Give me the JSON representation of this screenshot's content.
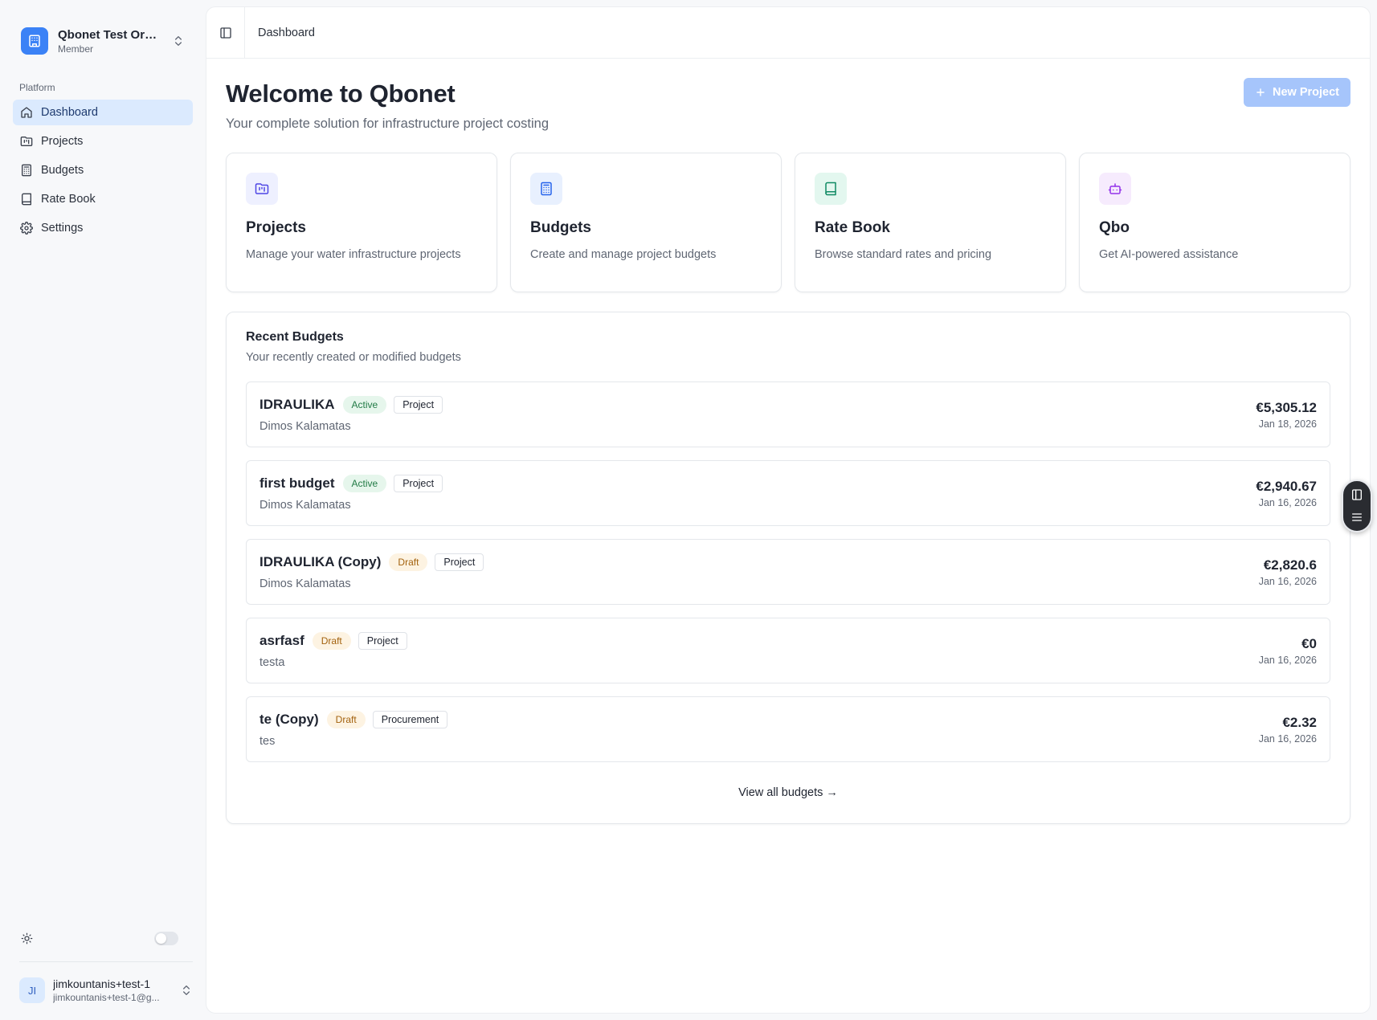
{
  "org": {
    "name": "Qbonet Test Orga...",
    "role": "Member"
  },
  "sidebar": {
    "section_label": "Platform",
    "items": [
      {
        "label": "Dashboard",
        "icon": "home-icon",
        "active": true
      },
      {
        "label": "Projects",
        "icon": "folder-kanban-icon"
      },
      {
        "label": "Budgets",
        "icon": "calculator-icon"
      },
      {
        "label": "Rate Book",
        "icon": "book-icon"
      },
      {
        "label": "Settings",
        "icon": "gear-icon"
      }
    ]
  },
  "user": {
    "initials": "JI",
    "name": "jimkountanis+test-1",
    "email": "jimkountanis+test-1@g..."
  },
  "header": {
    "breadcrumb": "Dashboard"
  },
  "page": {
    "title": "Welcome to Qbonet",
    "subtitle": "Your complete solution for infrastructure project costing",
    "new_button": "New Project"
  },
  "cards": [
    {
      "title": "Projects",
      "desc": "Manage your water infrastructure projects",
      "icon": "folder-kanban-icon",
      "bg": "#eef0ff",
      "fg": "#4f46e5"
    },
    {
      "title": "Budgets",
      "desc": "Create and manage project budgets",
      "icon": "calculator-icon",
      "bg": "#e8f0fe",
      "fg": "#2563eb"
    },
    {
      "title": "Rate Book",
      "desc": "Browse standard rates and pricing",
      "icon": "book-icon",
      "bg": "#e3f7ef",
      "fg": "#0f8a63"
    },
    {
      "title": "Qbo",
      "desc": "Get AI-powered assistance",
      "icon": "bot-icon",
      "bg": "#f6ebfd",
      "fg": "#9333ea"
    }
  ],
  "recent": {
    "title": "Recent Budgets",
    "subtitle": "Your recently created or modified budgets",
    "budgets": [
      {
        "name": "IDRAULIKA",
        "status": "Active",
        "type": "Project",
        "client": "Dimos Kalamatas",
        "amount": "€5,305.12",
        "date": "Jan 18, 2026"
      },
      {
        "name": "first budget",
        "status": "Active",
        "type": "Project",
        "client": "Dimos Kalamatas",
        "amount": "€2,940.67",
        "date": "Jan 16, 2026"
      },
      {
        "name": "IDRAULIKA (Copy)",
        "status": "Draft",
        "type": "Project",
        "client": "Dimos Kalamatas",
        "amount": "€2,820.6",
        "date": "Jan 16, 2026"
      },
      {
        "name": "asrfasf",
        "status": "Draft",
        "type": "Project",
        "client": "testa",
        "amount": "€0",
        "date": "Jan 16, 2026"
      },
      {
        "name": "te (Copy)",
        "status": "Draft",
        "type": "Procurement",
        "client": "tes",
        "amount": "€2.32",
        "date": "Jan 16, 2026"
      }
    ],
    "view_all": "View all budgets →"
  },
  "colors": {
    "accent": "#3b82f6",
    "active_nav_bg": "#dbeafe",
    "new_button_bg": "#a6c5fb"
  }
}
